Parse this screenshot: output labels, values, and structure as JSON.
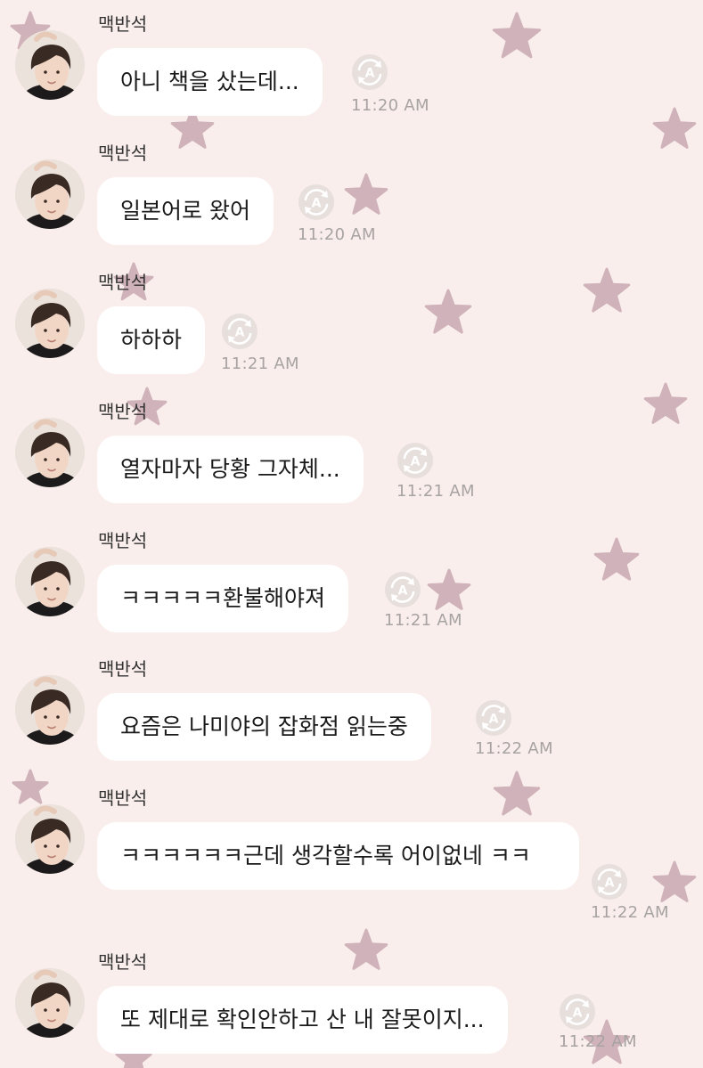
{
  "theme": {
    "background": "#f9eeec",
    "star_color": "#c9a9b2",
    "bubble_color": "#ffffff",
    "time_color": "#a7a3a2"
  },
  "messages": [
    {
      "sender": "맥반석",
      "text": "아니 책을 샀는데...",
      "time": "11:20 AM"
    },
    {
      "sender": "맥반석",
      "text": "일본어로 왔어",
      "time": "11:20 AM"
    },
    {
      "sender": "맥반석",
      "text": "하하하",
      "time": "11:21 AM"
    },
    {
      "sender": "맥반석",
      "text": "열자마자 당황 그자체...",
      "time": "11:21 AM"
    },
    {
      "sender": "맥반석",
      "text": "ㅋㅋㅋㅋㅋ환불해야져",
      "time": "11:21 AM"
    },
    {
      "sender": "맥반석",
      "text": "요즘은 나미야의 잡화점 읽는중",
      "time": "11:22 AM"
    },
    {
      "sender": "맥반석",
      "text": "ㅋㅋㅋㅋㅋㅋ근데 생각할수록 어이없네 ㅋㅋ",
      "time": "11:22 AM"
    },
    {
      "sender": "맥반석",
      "text": "또 제대로 확인안하고 산 내 잘못이지...",
      "time": "11:22 AM"
    }
  ]
}
